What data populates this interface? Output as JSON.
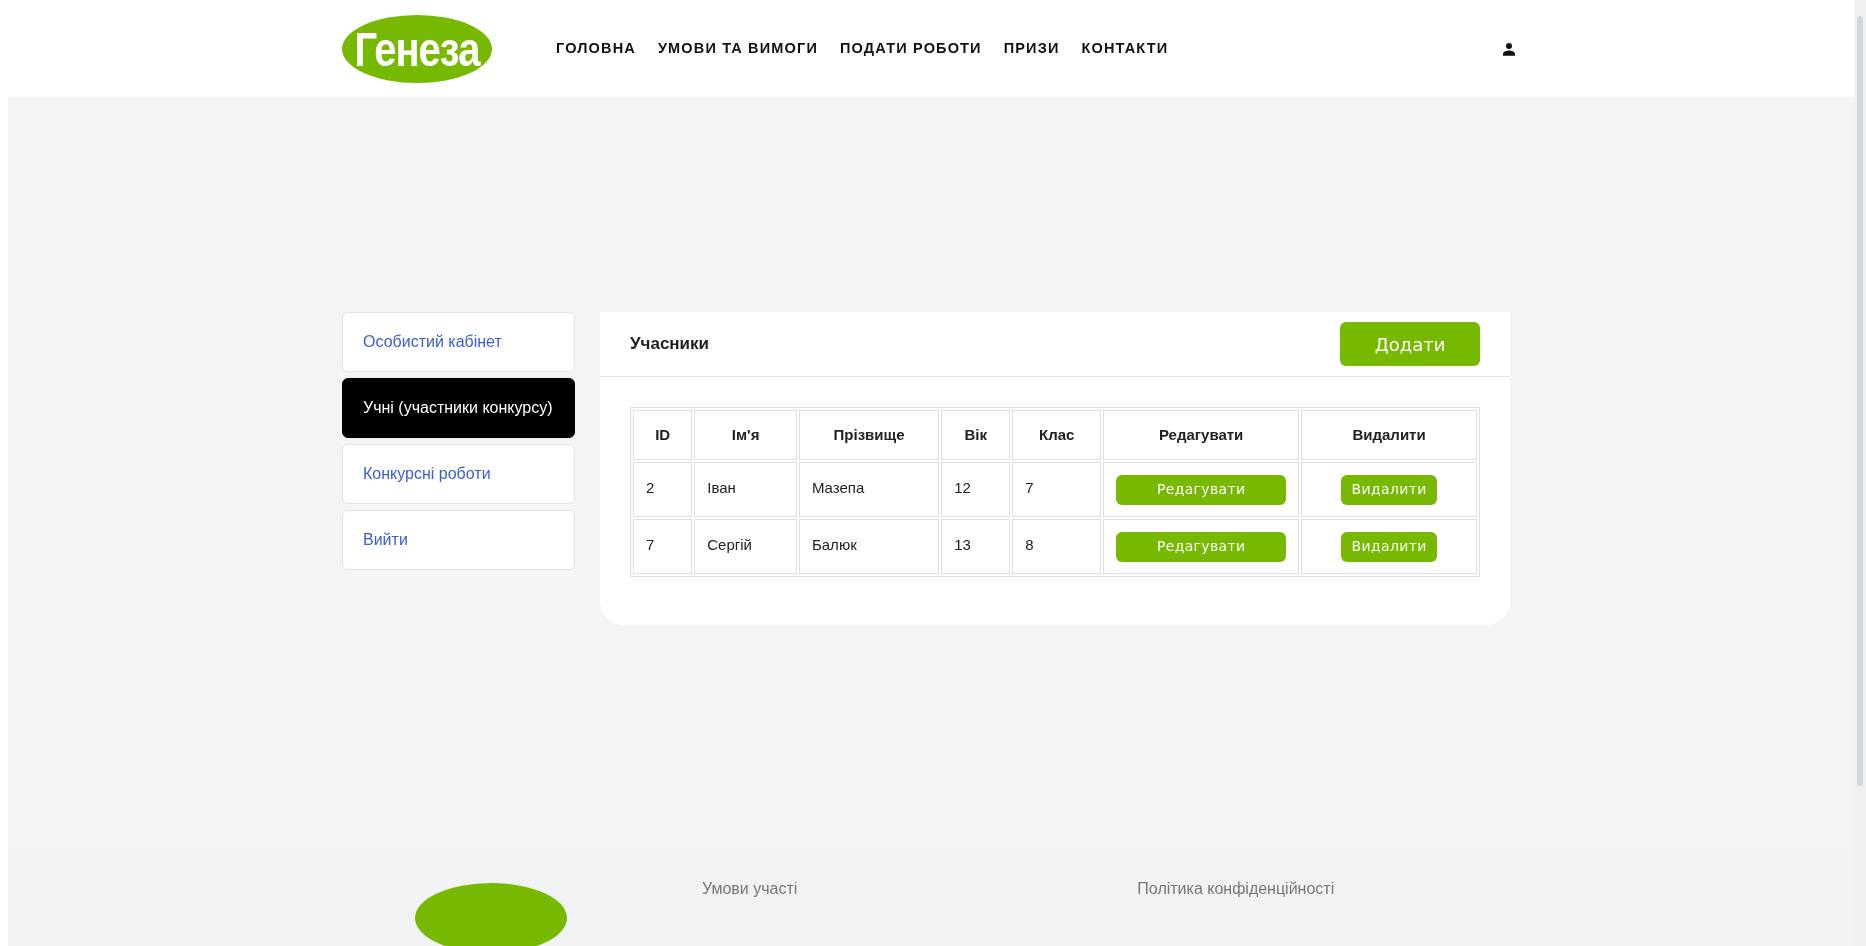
{
  "header": {
    "logo": "Генеза",
    "nav": [
      {
        "label": "ГОЛОВНА"
      },
      {
        "label": "УМОВИ ТА ВИМОГИ"
      },
      {
        "label": "ПОДАТИ РОБОТИ"
      },
      {
        "label": "ПРИЗИ"
      },
      {
        "label": "КОНТАКТИ"
      }
    ]
  },
  "sidebar": {
    "items": [
      {
        "label": "Особистий кабінет",
        "selected": false
      },
      {
        "label": "Учні (участники конкурсу)",
        "selected": true
      },
      {
        "label": "Конкурсні роботи",
        "selected": false
      },
      {
        "label": "Вийти",
        "selected": false
      }
    ]
  },
  "panel": {
    "title": "Учасники",
    "add_button": "Додати",
    "table": {
      "columns": [
        "ID",
        "Ім'я",
        "Прізвище",
        "Вік",
        "Клас",
        "Редагувати",
        "Видалити"
      ],
      "rows": [
        {
          "id": "2",
          "first_name": "Іван",
          "last_name": "Мазепа",
          "age": "12",
          "grade": "7",
          "edit": "Редагувати",
          "delete": "Видалити"
        },
        {
          "id": "7",
          "first_name": "Сергій",
          "last_name": "Балюк",
          "age": "13",
          "grade": "8",
          "edit": "Редагувати",
          "delete": "Видалити"
        }
      ]
    }
  },
  "footer": {
    "links": [
      "Умови участі",
      "Політика конфіденційності"
    ]
  }
}
